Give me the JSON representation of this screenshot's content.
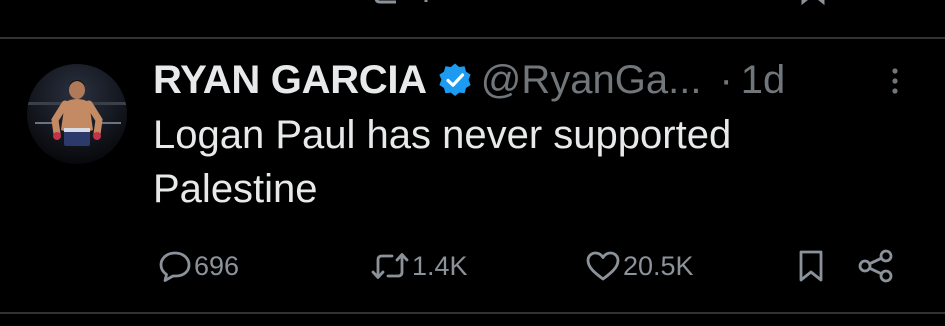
{
  "tweet": {
    "display_name": "RYAN GARCIA",
    "handle": "@RyanGa...",
    "separator": "·",
    "time": "1d",
    "text": "Logan Paul has never supported Palestine",
    "verified_badge_color": "#1d9bf0"
  },
  "actions": {
    "reply_count": "696",
    "retweet_count": "1.4K",
    "like_count": "20.5K"
  },
  "icons": [
    "reply-icon",
    "retweet-icon",
    "like-icon",
    "bookmark-icon",
    "share-icon",
    "more-icon",
    "verified-icon"
  ],
  "colors": {
    "background": "#000000",
    "primary_text": "#e7e9ea",
    "secondary_text": "#71767b",
    "divider": "#2f3336"
  }
}
